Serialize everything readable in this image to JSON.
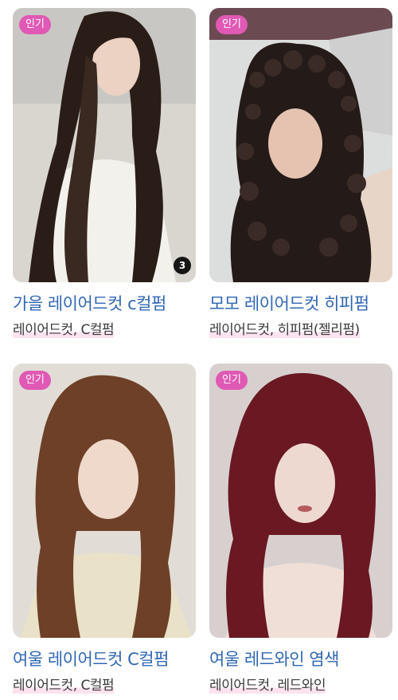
{
  "cards": [
    {
      "badge": "인기",
      "title": "가을 레이어드컷 c컬펌",
      "tags": "레이어드컷, C컬펌",
      "photo_count": "3",
      "image": "photo-long-dark-layered-hair-white-shirt"
    },
    {
      "badge": "인기",
      "title": "모모 레이어드컷 히피펌",
      "tags": "레이어드컷, 히피펌(젤리펌)",
      "image": "photo-curly-dark-hippie-perm"
    },
    {
      "badge": "인기",
      "title": "여울 레이어드컷 C컬펌",
      "tags": "레이어드컷, C컬펌",
      "image": "photo-brown-layered-hair-bangs"
    },
    {
      "badge": "인기",
      "title": "여울 레드와인 염색",
      "tags": "레이어드컷, 레드와인",
      "image": "photo-wine-red-layered-hair"
    }
  ],
  "colors": {
    "badge_bg": "#e059b4",
    "title_text": "#2f67b4",
    "tag_highlight": "#fde3ef"
  }
}
